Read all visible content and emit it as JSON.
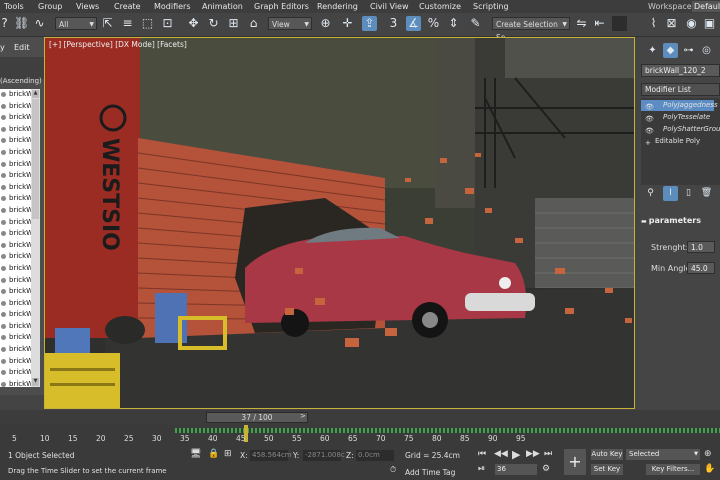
{
  "menu": [
    "Tools",
    "Group",
    "Views",
    "Create",
    "Modifiers",
    "Animation",
    "Graph Editors",
    "Rendering",
    "Civil View",
    "Customize",
    "Scripting"
  ],
  "workspace": {
    "label": "Workspaces:",
    "value": "Default"
  },
  "toolbar": {
    "filter_value": "All",
    "refcoord_value": "View",
    "selection_set_value": "Create Selection Se"
  },
  "left_panel": {
    "tab_display": "y",
    "tab_edit": "Edit",
    "sort_label": "(Ascending)",
    "rows": [
      "brickW",
      "brickW",
      "brickW",
      "brickW",
      "brickW",
      "brickW",
      "brickW",
      "brickW",
      "brickW",
      "brickW",
      "brickW",
      "brickW",
      "brickW",
      "brickW",
      "brickW",
      "brickW",
      "brickW",
      "brickW",
      "brickW",
      "brickW",
      "brickW",
      "brickW",
      "brickW",
      "brickW",
      "brickW",
      "brickW"
    ]
  },
  "viewport": {
    "label": "[+] [Perspective] [DX Mode] [Facets]",
    "graffiti": "WESTSIO"
  },
  "right_panel": {
    "object_name": "brickWall_120_2",
    "modifier_list": "Modifier List",
    "stack": [
      {
        "label": "PolyJaggedness",
        "selected": true
      },
      {
        "label": "PolyTesselate",
        "selected": false
      },
      {
        "label": "PolyShatterGroup",
        "selected": false
      },
      {
        "label": "Editable Poly",
        "selected": false
      }
    ],
    "rollout_title": "parameters",
    "params": [
      {
        "label": "Strenght:",
        "value": "1.0"
      },
      {
        "label": "Min Angle",
        "value": "45.0"
      }
    ]
  },
  "timeline": {
    "slider_text": "37 / 100",
    "ticks": [
      "5",
      "10",
      "15",
      "20",
      "25",
      "30",
      "35",
      "40",
      "45",
      "50",
      "55",
      "60",
      "65",
      "70",
      "75",
      "80",
      "85",
      "90",
      "95"
    ]
  },
  "status": {
    "selected": "1 Object Selected",
    "prompt": "Drag the Time Slider to set the current frame",
    "x_label": "X:",
    "x_value": "458.564cm",
    "y_label": "Y:",
    "y_value": "-2871.008c",
    "z_label": "Z:",
    "z_value": "0.0cm",
    "grid": "Grid = 25.4cm",
    "add_time_tag": "Add Time Tag",
    "frame_field": "36",
    "auto_key": "Auto Key",
    "set_key": "Set Key",
    "selected_dropdown": "Selected",
    "key_filters": "Key Filters..."
  }
}
